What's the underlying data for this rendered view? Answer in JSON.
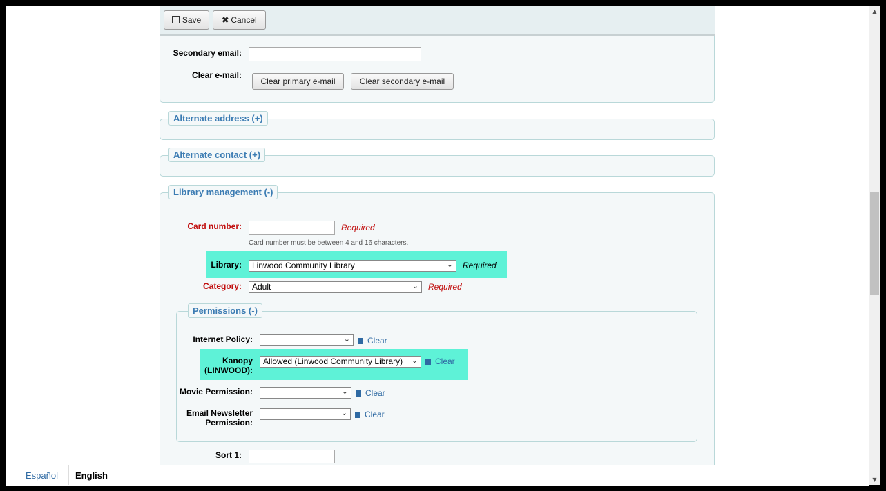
{
  "toolbar": {
    "save_label": "Save",
    "cancel_label": "Cancel"
  },
  "contact": {
    "secondary_email_label": "Secondary email:",
    "secondary_email_value": "",
    "clear_email_label": "Clear e-mail:",
    "clear_primary_label": "Clear primary e-mail",
    "clear_secondary_label": "Clear secondary e-mail"
  },
  "sections": {
    "alternate_address": "Alternate address (+)",
    "alternate_contact": "Alternate contact (+)",
    "library_management": "Library management (-)",
    "permissions": "Permissions (-)"
  },
  "library_management": {
    "card_number_label": "Card number:",
    "card_number_value": "",
    "card_number_hint": "Card number must be between 4 and 16 characters.",
    "required_text": "Required",
    "library_label": "Library:",
    "library_value": "Linwood Community Library",
    "category_label": "Category:",
    "category_value": "Adult",
    "sort1_label": "Sort 1:",
    "sort1_value": ""
  },
  "permissions": {
    "clear_label": "Clear",
    "internet_policy_label": "Internet Policy:",
    "internet_policy_value": "",
    "kanopy_label_1": "Kanopy",
    "kanopy_label_2": "(LINWOOD):",
    "kanopy_value": "Allowed (Linwood Community Library)",
    "movie_label": "Movie Permission:",
    "movie_value": "",
    "newsletter_label_1": "Email Newsletter",
    "newsletter_label_2": "Permission:",
    "newsletter_value": ""
  },
  "footer": {
    "lang_es": "Español",
    "lang_en": "English"
  },
  "colors": {
    "highlight": "#5ef2d7",
    "link": "#3c7cb3",
    "required": "#c10f0f"
  }
}
